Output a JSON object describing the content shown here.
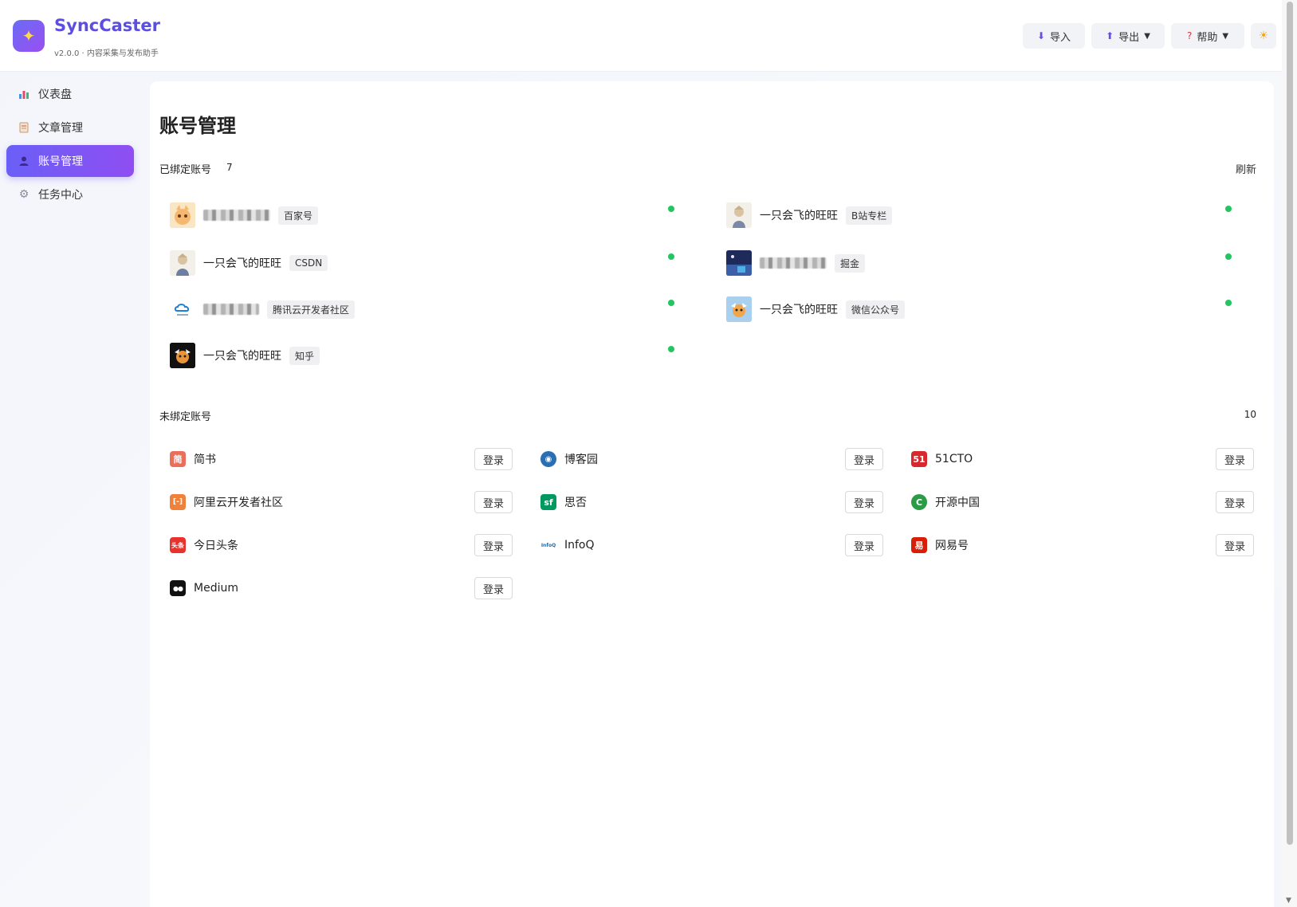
{
  "app": {
    "name": "SyncCaster",
    "version": "v2.0.0 · 内容采集与发布助手"
  },
  "header": {
    "import_label": "导入",
    "export_label": "导出",
    "help_label": "帮助"
  },
  "sidebar": {
    "items": [
      {
        "label": "仪表盘",
        "icon": "chart-icon"
      },
      {
        "label": "文章管理",
        "icon": "document-icon"
      },
      {
        "label": "账号管理",
        "icon": "user-icon",
        "active": true
      },
      {
        "label": "任务中心",
        "icon": "gear-icon"
      }
    ]
  },
  "main": {
    "title": "账号管理",
    "bound": {
      "title": "已绑定账号",
      "count": "7",
      "refresh_label": "刷新",
      "accounts": [
        {
          "name": "",
          "platform": "百家号",
          "status": "online",
          "blurred": true,
          "avatar_color": "#f7d7a2"
        },
        {
          "name": "一只会飞的旺旺",
          "platform": "B站专栏",
          "status": "online",
          "blurred": false,
          "avatar_color": "#e9e3dc"
        },
        {
          "name": "一只会飞的旺旺",
          "platform": "CSDN",
          "status": "online",
          "blurred": false,
          "avatar_color": "#e9e3dc"
        },
        {
          "name": "",
          "platform": "掘金",
          "status": "online",
          "blurred": true,
          "avatar_color": "#2c3e73"
        },
        {
          "name": "",
          "platform": "腾讯云开发者社区",
          "status": "online",
          "blurred": true,
          "avatar_color": "#ffffff"
        },
        {
          "name": "一只会飞的旺旺",
          "platform": "微信公众号",
          "status": "online",
          "blurred": false,
          "avatar_color": "#9cc7e8"
        },
        {
          "name": "一只会飞的旺旺",
          "platform": "知乎",
          "status": "online",
          "blurred": false,
          "avatar_color": "#111111"
        }
      ]
    },
    "unbound": {
      "title": "未绑定账号",
      "count": "10",
      "login_label": "登录",
      "platforms": [
        {
          "name": "简书",
          "glyph": "简",
          "color": "#ea6f5a"
        },
        {
          "name": "博客园",
          "glyph": "◉",
          "color": "#2a6fb3"
        },
        {
          "name": "51CTO",
          "glyph": "51",
          "color": "#d9272e"
        },
        {
          "name": "阿里云开发者社区",
          "glyph": "[-]",
          "color": "#f0813a"
        },
        {
          "name": "思否",
          "glyph": "sf",
          "color": "#009a61"
        },
        {
          "name": "开源中国",
          "glyph": "C",
          "color": "#2b9c45"
        },
        {
          "name": "今日头条",
          "glyph": "头条",
          "color": "#e8322d"
        },
        {
          "name": "InfoQ",
          "glyph": "InfoQ",
          "color": "#1f6ab5"
        },
        {
          "name": "网易号",
          "glyph": "易",
          "color": "#d81e06"
        },
        {
          "name": "Medium",
          "glyph": "●●",
          "color": "#111111"
        }
      ]
    }
  }
}
